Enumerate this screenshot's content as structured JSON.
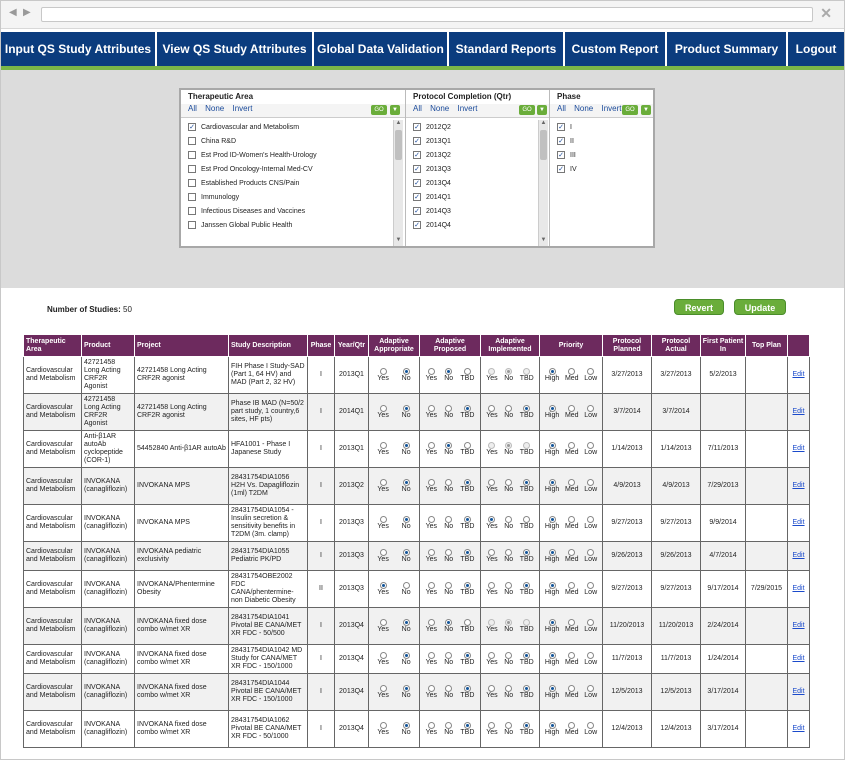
{
  "browser": {
    "back_icon": "left-arrow-icon",
    "forward_icon": "right-arrow-icon",
    "close_glyph": "✕"
  },
  "nav": [
    {
      "label": "Input QS Study Attributes"
    },
    {
      "label": "View QS Study Attributes"
    },
    {
      "label": "Global Data Validation"
    },
    {
      "label": "Standard Reports"
    },
    {
      "label": "Custom Report"
    },
    {
      "label": "Product Summary"
    },
    {
      "label": "Logout"
    }
  ],
  "filters": {
    "ta": {
      "header": "Therapeutic Area",
      "all": "All",
      "none": "None",
      "invert": "Invert",
      "go": "GO",
      "items": [
        {
          "label": "Cardiovascular and Metabolism",
          "checked": true
        },
        {
          "label": "China R&D",
          "checked": false
        },
        {
          "label": "Est Prod ID-Women's Health-Urology",
          "checked": false
        },
        {
          "label": "Est Prod Oncology-Internal Med-CV",
          "checked": false
        },
        {
          "label": "Established Products CNS/Pain",
          "checked": false
        },
        {
          "label": "Immunology",
          "checked": false
        },
        {
          "label": "Infectious Diseases and Vaccines",
          "checked": false
        },
        {
          "label": "Janssen Global Public Health",
          "checked": false
        }
      ]
    },
    "pc": {
      "header": "Protocol Completion (Qtr)",
      "all": "All",
      "none": "None",
      "invert": "Invert",
      "go": "GO",
      "items": [
        {
          "label": "2012Q2",
          "checked": true
        },
        {
          "label": "2013Q1",
          "checked": true
        },
        {
          "label": "2013Q2",
          "checked": true
        },
        {
          "label": "2013Q3",
          "checked": true
        },
        {
          "label": "2013Q4",
          "checked": true
        },
        {
          "label": "2014Q1",
          "checked": true
        },
        {
          "label": "2014Q3",
          "checked": true
        },
        {
          "label": "2014Q4",
          "checked": true
        }
      ]
    },
    "ph": {
      "header": "Phase",
      "all": "All",
      "none": "None",
      "invert": "Invert",
      "go": "GO",
      "items": [
        {
          "label": "I",
          "checked": true
        },
        {
          "label": "II",
          "checked": true
        },
        {
          "label": "III",
          "checked": true
        },
        {
          "label": "IV",
          "checked": true
        }
      ]
    }
  },
  "summary": {
    "label": "Number of Studies:",
    "count": "50"
  },
  "buttons": {
    "revert": "Revert",
    "update": "Update"
  },
  "table": {
    "headers": [
      "Therapeutic Area",
      "Product",
      "Project",
      "Study Description",
      "Phase",
      "Year/Qtr",
      "Adaptive Appropriate",
      "Adaptive Proposed",
      "Adaptive Implemented",
      "Priority",
      "Protocol Planned",
      "Protocol Actual",
      "First Patient In",
      "Top Plan",
      ""
    ],
    "labels": {
      "yes": "Yes",
      "no": "No",
      "tbd": "TBD",
      "high": "High",
      "med": "Med",
      "low": "Low",
      "edit": "Edit"
    },
    "rows": [
      {
        "ta": "Cardiovascular and Metabolism",
        "product": "42721458 Long Acting CRF2R Agonist",
        "project": "42721458 Long Acting CRF2R agonist",
        "desc": "FIH Phase I Study-SAD (Part 1, 64 HV) and MAD (Part 2, 32 HV)",
        "phase": "I",
        "yq": "2013Q1",
        "appropriate": "No",
        "proposed": "No",
        "implemented": "No",
        "impl_disabled": true,
        "priority": "High",
        "planned": "3/27/2013",
        "actual": "3/27/2013",
        "fpi": "5/2/2013",
        "top": ""
      },
      {
        "ta": "Cardiovascular and Metabolism",
        "product": "42721458 Long Acting CRF2R Agonist",
        "project": "42721458 Long Acting CRF2R agonist",
        "desc": "Phase IB MAD (N=50/2 part study, 1 country,6 sites, HF pts)",
        "phase": "I",
        "yq": "2014Q1",
        "appropriate": "No",
        "proposed": "TBD",
        "implemented": "TBD",
        "impl_disabled": false,
        "priority": "High",
        "planned": "3/7/2014",
        "actual": "3/7/2014",
        "fpi": "",
        "top": ""
      },
      {
        "ta": "Cardiovascular and Metabolism",
        "product": "Anti-β1AR autoAb cyclopeptide (COR-1)",
        "project": "54452840 Anti-β1AR autoAb",
        "desc": "HFA1001 - Phase I Japanese Study",
        "phase": "I",
        "yq": "2013Q1",
        "appropriate": "No",
        "proposed": "No",
        "implemented": "No",
        "impl_disabled": true,
        "priority": "High",
        "planned": "1/14/2013",
        "actual": "1/14/2013",
        "fpi": "7/11/2013",
        "top": ""
      },
      {
        "ta": "Cardiovascular and Metabolism",
        "product": "INVOKANA (canagliflozin)",
        "project": "INVOKANA MPS",
        "desc": "28431754DIA1056 H2H Vs. Dapagliflozin (1ml) T2DM",
        "phase": "I",
        "yq": "2013Q2",
        "appropriate": "No",
        "proposed": "TBD",
        "implemented": "TBD",
        "impl_disabled": false,
        "priority": "High",
        "planned": "4/9/2013",
        "actual": "4/9/2013",
        "fpi": "7/29/2013",
        "top": ""
      },
      {
        "ta": "Cardiovascular and Metabolism",
        "product": "INVOKANA (canagliflozin)",
        "project": "INVOKANA MPS",
        "desc": "28431754DIA1054 - Insulin secretion & sensitivity benefits in T2DM (3m. clamp)",
        "phase": "I",
        "yq": "2013Q3",
        "appropriate": "No",
        "proposed": "TBD",
        "implemented": "Yes",
        "impl_disabled": false,
        "priority": "High",
        "planned": "9/27/2013",
        "actual": "9/27/2013",
        "fpi": "9/9/2014",
        "top": ""
      },
      {
        "ta": "Cardiovascular and Metabolism",
        "product": "INVOKANA (canagliflozin)",
        "project": "INVOKANA pediatric exclusivity",
        "desc": "28431754DIA1055 Pediatric PK/PD",
        "phase": "I",
        "yq": "2013Q3",
        "appropriate": "No",
        "proposed": "TBD",
        "implemented": "TBD",
        "impl_disabled": false,
        "priority": "High",
        "planned": "9/26/2013",
        "actual": "9/26/2013",
        "fpi": "4/7/2014",
        "top": ""
      },
      {
        "ta": "Cardiovascular and Metabolism",
        "product": "INVOKANA (canagliflozin)",
        "project": "INVOKANA/Phentermine Obesity",
        "desc": "28431754OBE2002 FDC CANA/phentermine-non Diabetic Obesity",
        "phase": "II",
        "yq": "2013Q3",
        "appropriate": "Yes",
        "proposed": "TBD",
        "implemented": "TBD",
        "impl_disabled": false,
        "priority": "High",
        "planned": "9/27/2013",
        "actual": "9/27/2013",
        "fpi": "9/17/2014",
        "top": "7/29/2015"
      },
      {
        "ta": "Cardiovascular and Metabolism",
        "product": "INVOKANA (canagliflozin)",
        "project": "INVOKANA fixed dose combo w/met XR",
        "desc": "28431754DIA1041 Pivotal BE CANA/MET XR FDC - 50/500",
        "phase": "I",
        "yq": "2013Q4",
        "appropriate": "No",
        "proposed": "No",
        "implemented": "No",
        "impl_disabled": true,
        "priority": "High",
        "planned": "11/20/2013",
        "actual": "11/20/2013",
        "fpi": "2/24/2014",
        "top": ""
      },
      {
        "ta": "Cardiovascular and Metabolism",
        "product": "INVOKANA (canagliflozin)",
        "project": "INVOKANA fixed dose combo w/met XR",
        "desc": "28431754DIA1042 MD Study for CANA/MET XR FDC - 150/1000",
        "phase": "I",
        "yq": "2013Q4",
        "appropriate": "No",
        "proposed": "TBD",
        "implemented": "TBD",
        "impl_disabled": false,
        "priority": "High",
        "planned": "11/7/2013",
        "actual": "11/7/2013",
        "fpi": "1/24/2014",
        "top": ""
      },
      {
        "ta": "Cardiovascular and Metabolism",
        "product": "INVOKANA (canagliflozin)",
        "project": "INVOKANA fixed dose combo w/met XR",
        "desc": "28431754DIA1044 Pivotal BE CANA/MET XR FDC - 150/1000",
        "phase": "I",
        "yq": "2013Q4",
        "appropriate": "No",
        "proposed": "TBD",
        "implemented": "TBD",
        "impl_disabled": false,
        "priority": "High",
        "planned": "12/5/2013",
        "actual": "12/5/2013",
        "fpi": "3/17/2014",
        "top": ""
      },
      {
        "ta": "Cardiovascular and Metabolism",
        "product": "INVOKANA (canagliflozin)",
        "project": "INVOKANA fixed dose combo w/met XR",
        "desc": "28431754DIA1062 Pivotal BE CANA/MET XR FDC - 50/1000",
        "phase": "I",
        "yq": "2013Q4",
        "appropriate": "No",
        "proposed": "TBD",
        "implemented": "TBD",
        "impl_disabled": false,
        "priority": "High",
        "planned": "12/4/2013",
        "actual": "12/4/2013",
        "fpi": "3/17/2014",
        "top": ""
      }
    ]
  }
}
